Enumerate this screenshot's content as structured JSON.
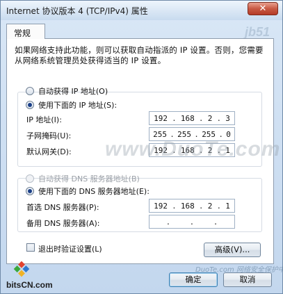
{
  "window": {
    "title": "Internet 协议版本 4 (TCP/IPv4) 属性",
    "close_symbol": "✕"
  },
  "tabs": [
    {
      "label": "常规"
    }
  ],
  "description": "如果网络支持此功能，则可以获取自动指派的 IP 设置。否则，您需要从网络系统管理员处获得适当的 IP 设置。",
  "ip_section": {
    "auto_option": "自动获得 IP 地址(O)",
    "manual_option": "使用下面的 IP 地址(S):",
    "selected": "manual",
    "fields": [
      {
        "label": "IP 地址(I):",
        "octets": [
          "192",
          "168",
          "2",
          "3"
        ]
      },
      {
        "label": "子网掩码(U):",
        "octets": [
          "255",
          "255",
          "255",
          "0"
        ]
      },
      {
        "label": "默认网关(D):",
        "octets": [
          "192",
          "168",
          "2",
          "1"
        ]
      }
    ]
  },
  "dns_section": {
    "auto_option": "自动获得 DNS 服务器地址(B)",
    "manual_option": "使用下面的 DNS 服务器地址(E):",
    "selected": "manual",
    "fields": [
      {
        "label": "首选 DNS 服务器(P):",
        "octets": [
          "192",
          "168",
          "2",
          "1"
        ]
      },
      {
        "label": "备用 DNS 服务器(A):",
        "octets": [
          "",
          "",
          "",
          ""
        ]
      }
    ]
  },
  "validate_on_exit": {
    "label": "退出时验证设置(L)",
    "checked": false
  },
  "buttons": {
    "advanced": "高级(V)...",
    "ok": "确定",
    "cancel": "取消"
  },
  "watermarks": {
    "center": "www.DuoTe.com",
    "corner": "jb51",
    "bottom_right": "DuoTe.com 网络安全保护中心",
    "logo": "bitsCN.com"
  }
}
